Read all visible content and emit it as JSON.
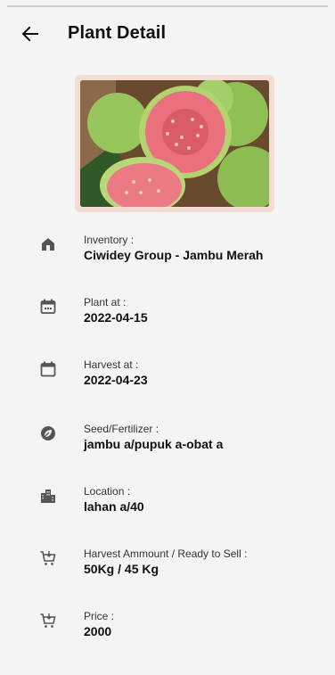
{
  "header": {
    "title": "Plant Detail"
  },
  "details": [
    {
      "icon": "home-icon",
      "label": "Inventory :",
      "value": "Ciwidey Group - Jambu  Merah"
    },
    {
      "icon": "calendar-icon",
      "label": "Plant at :",
      "value": "2022-04-15"
    },
    {
      "icon": "calendar-icon",
      "label": "Harvest at :",
      "value": "2022-04-23"
    },
    {
      "icon": "seed-icon",
      "label": "Seed/Fertilizer :",
      "value": "jambu a/pupuk a-obat a"
    },
    {
      "icon": "city-icon",
      "label": "Location :",
      "value": "lahan a/40"
    },
    {
      "icon": "cart-icon",
      "label": "Harvest Ammount / Ready to Sell :",
      "value": "50Kg / 45 Kg"
    },
    {
      "icon": "cart-icon",
      "label": "Price :",
      "value": "2000"
    }
  ],
  "colors": {
    "background": "#f4f4f4",
    "icon": "#555555",
    "guava_flesh": "#e9707c",
    "guava_skin": "#8fc15a"
  }
}
